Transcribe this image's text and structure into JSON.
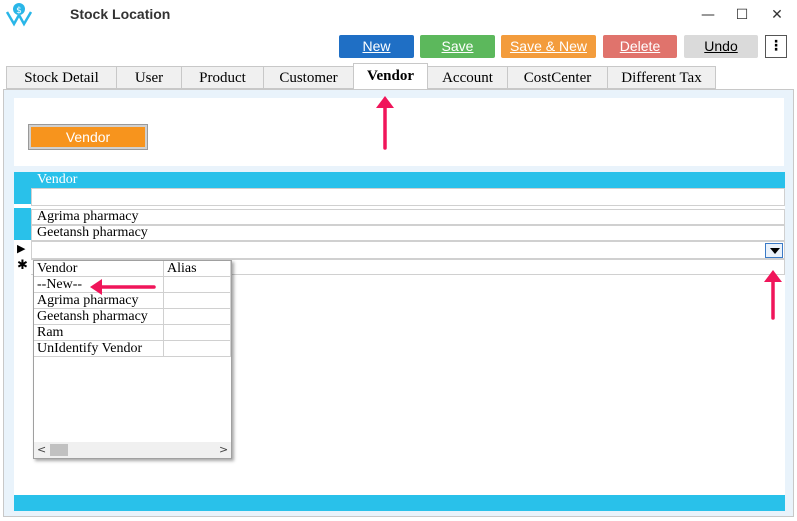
{
  "window": {
    "title": "Stock Location",
    "minimize_glyph": "—",
    "maximize_glyph": "☐",
    "close_glyph": "✕",
    "logo_icon": "rupee-lotus-logo"
  },
  "toolbar": {
    "new_label": "New",
    "save_label": "Save",
    "save_new_label": "Save & New",
    "delete_label": "Delete",
    "undo_label": "Undo",
    "more_glyph": "⋮",
    "colors": {
      "new": "#1f6fc5",
      "save": "#5cb85c",
      "save_new": "#f39c3c",
      "delete": "#e0736c",
      "undo": "#dadada"
    }
  },
  "tabs": [
    {
      "label": "Stock Detail",
      "active": false
    },
    {
      "label": "User",
      "active": false
    },
    {
      "label": "Product",
      "active": false
    },
    {
      "label": "Customer",
      "active": false
    },
    {
      "label": "Vendor",
      "active": true
    },
    {
      "label": "Account",
      "active": false
    },
    {
      "label": "CostCenter",
      "active": false
    },
    {
      "label": "Different Tax",
      "active": false
    }
  ],
  "section": {
    "label": "Vendor",
    "color": "#f7941d"
  },
  "grid": {
    "header": "Vendor",
    "accent_color": "#29c1ea",
    "rows": [
      "",
      "Agrima pharmacy",
      "Geetansh pharmacy",
      ""
    ],
    "current_row_marker": "▶",
    "new_row_marker": "✱",
    "dropdown_icon": "chevron-down-icon"
  },
  "dropdown_popup": {
    "columns": [
      "Vendor",
      "Alias"
    ],
    "rows": [
      {
        "vendor": "--New--",
        "alias": ""
      },
      {
        "vendor": "Agrima pharmacy",
        "alias": ""
      },
      {
        "vendor": "Geetansh pharmacy",
        "alias": ""
      },
      {
        "vendor": "Ram",
        "alias": ""
      },
      {
        "vendor": "UnIdentify Vendor",
        "alias": ""
      }
    ],
    "scroll_left_glyph": "<",
    "scroll_right_glyph": ">"
  },
  "annotations": {
    "arrow_color": "#f0155a"
  }
}
